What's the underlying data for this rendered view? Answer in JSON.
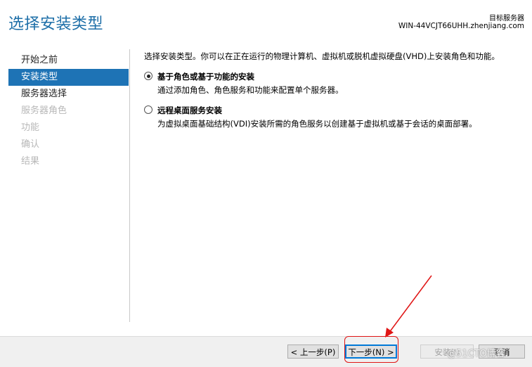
{
  "header": {
    "title": "选择安装类型",
    "destination_label": "目标服务器",
    "destination_server": "WIN-44VCJT66UHH.zhenjiang.com"
  },
  "sidebar": {
    "items": [
      {
        "label": "开始之前",
        "state": "normal"
      },
      {
        "label": "安装类型",
        "state": "active"
      },
      {
        "label": "服务器选择",
        "state": "normal"
      },
      {
        "label": "服务器角色",
        "state": "disabled"
      },
      {
        "label": "功能",
        "state": "disabled"
      },
      {
        "label": "确认",
        "state": "disabled"
      },
      {
        "label": "结果",
        "state": "disabled"
      }
    ]
  },
  "main": {
    "intro": "选择安装类型。你可以在正在运行的物理计算机、虚拟机或脱机虚拟硬盘(VHD)上安装角色和功能。",
    "options": [
      {
        "label": "基于角色或基于功能的安装",
        "description": "通过添加角色、角色服务和功能来配置单个服务器。",
        "selected": true
      },
      {
        "label": "远程桌面服务安装",
        "description": "为虚拟桌面基础结构(VDI)安装所需的角色服务以创建基于虚拟机或基于会话的桌面部署。",
        "selected": false
      }
    ]
  },
  "footer": {
    "prev_label": "< 上一步(P)",
    "next_label": "下一步(N) >",
    "install_label": "安装(I)",
    "cancel_label": "取消"
  },
  "watermark": "@51CTO博客",
  "colors": {
    "title": "#1e6fa8",
    "active_nav": "#1e73b5",
    "annotation": "#e01515"
  }
}
